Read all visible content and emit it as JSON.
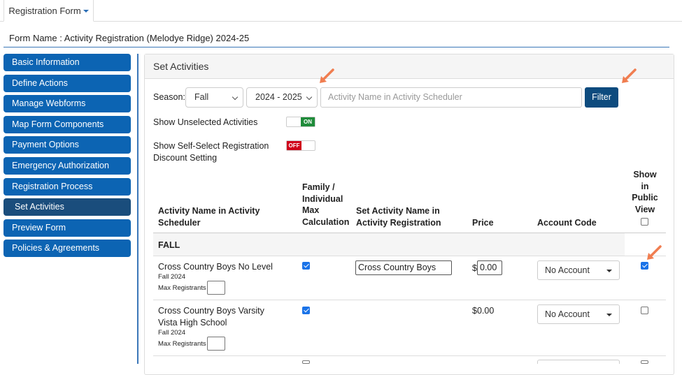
{
  "tab": {
    "label": "Registration Form"
  },
  "form_name": "Form Name : Activity Registration (Melodye Ridge) 2024-25",
  "sidebar": {
    "items": [
      {
        "label": "Basic Information",
        "active": false
      },
      {
        "label": "Define Actions",
        "active": false
      },
      {
        "label": "Manage Webforms",
        "active": false
      },
      {
        "label": "Map Form Components",
        "active": false
      },
      {
        "label": "Payment Options",
        "active": false
      },
      {
        "label": "Emergency Authorization",
        "active": false
      },
      {
        "label": "Registration Process",
        "active": false
      },
      {
        "label": "Set Activities",
        "active": true
      },
      {
        "label": "Preview Form",
        "active": false
      },
      {
        "label": "Policies & Agreements",
        "active": false
      }
    ]
  },
  "panel": {
    "title": "Set Activities",
    "filters": {
      "season_label": "Season:",
      "season_value": "Fall",
      "year_value": "2024 - 2025",
      "search_placeholder": "Activity Name in Activity Scheduler",
      "filter_label": "Filter"
    },
    "toggles": {
      "unselected_label": "Show Unselected Activities",
      "unselected_state": "ON",
      "selfselect_label_1": "Show Self-Select Registration",
      "selfselect_label_2": "Discount Setting",
      "selfselect_state": "OFF"
    },
    "table": {
      "headers": {
        "name_1": "Activity Name in Activity",
        "name_2": "Scheduler",
        "family_1": "Family /",
        "family_2": "Individual",
        "family_3": "Max",
        "family_4": "Calculation",
        "setname_1": "Set Activity Name in",
        "setname_2": "Activity Registration",
        "price": "Price",
        "account": "Account Code",
        "show_1": "Show",
        "show_2": "in",
        "show_3": "Public",
        "show_4": "View"
      },
      "section": "FALL",
      "rows": [
        {
          "name": "Cross Country Boys No Level",
          "season": "Fall 2024",
          "max_label": "Max Registrants",
          "family_checked": true,
          "set_name": "Cross Country Boys",
          "price_prefix": "$",
          "price_value": "0.00",
          "account": "No Account",
          "public": true
        },
        {
          "name": "Cross Country Boys Varsity",
          "name_2": "Vista High School",
          "season": "Fall 2024",
          "max_label": "Max Registrants",
          "family_checked": true,
          "price": "$0.00",
          "account": "No Account",
          "public": false
        }
      ]
    }
  },
  "colors": {
    "accent": "#0c64b3",
    "active": "#1a4d7c",
    "filter": "#0d4b7e",
    "on": "#1f8c3a",
    "off": "#d0021b",
    "arrow": "#f07d50"
  },
  "icons": [
    "caret-down-icon",
    "chevron-down-icon",
    "checkbox-icon",
    "dropdown-triangle-icon",
    "annotation-arrow-icon"
  ]
}
